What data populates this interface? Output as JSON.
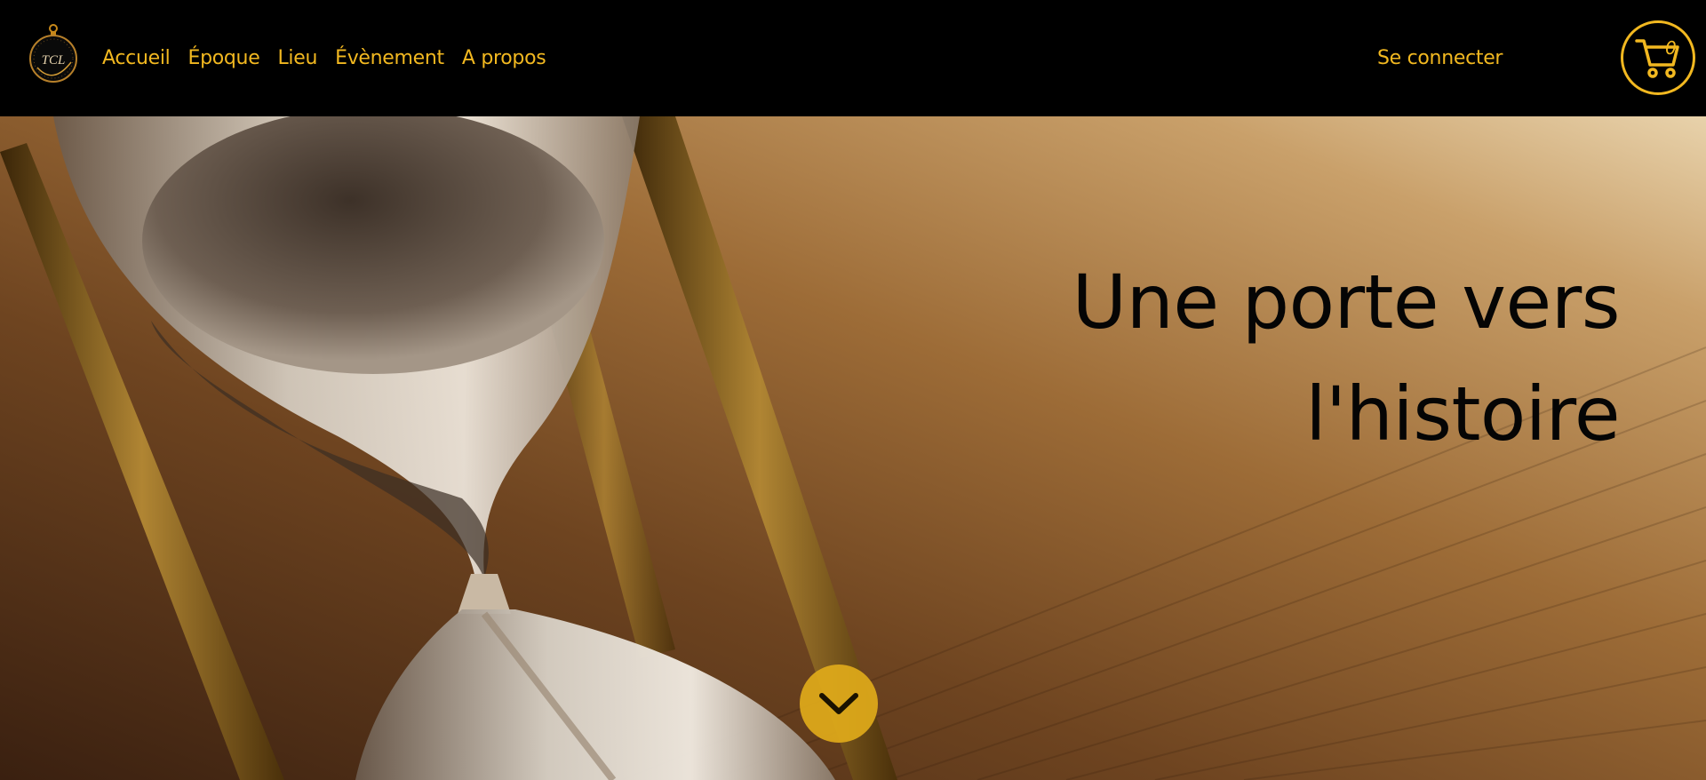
{
  "nav": {
    "logo_text": "TCL",
    "links": [
      {
        "label": "Accueil"
      },
      {
        "label": "Époque"
      },
      {
        "label": "Lieu"
      },
      {
        "label": "Évènement"
      },
      {
        "label": "A propos"
      }
    ],
    "login_label": "Se connecter",
    "cart_count": "0"
  },
  "hero": {
    "title_line1": "Une porte vers",
    "title_line2": "l'histoire"
  },
  "colors": {
    "accent": "#f2b820",
    "navbar_bg": "#000000",
    "scroll_button_bg": "#e0aa1a"
  },
  "icons": {
    "logo": "pocket-watch-logo-icon",
    "cart": "shopping-cart-icon",
    "scroll": "chevron-down-icon"
  }
}
